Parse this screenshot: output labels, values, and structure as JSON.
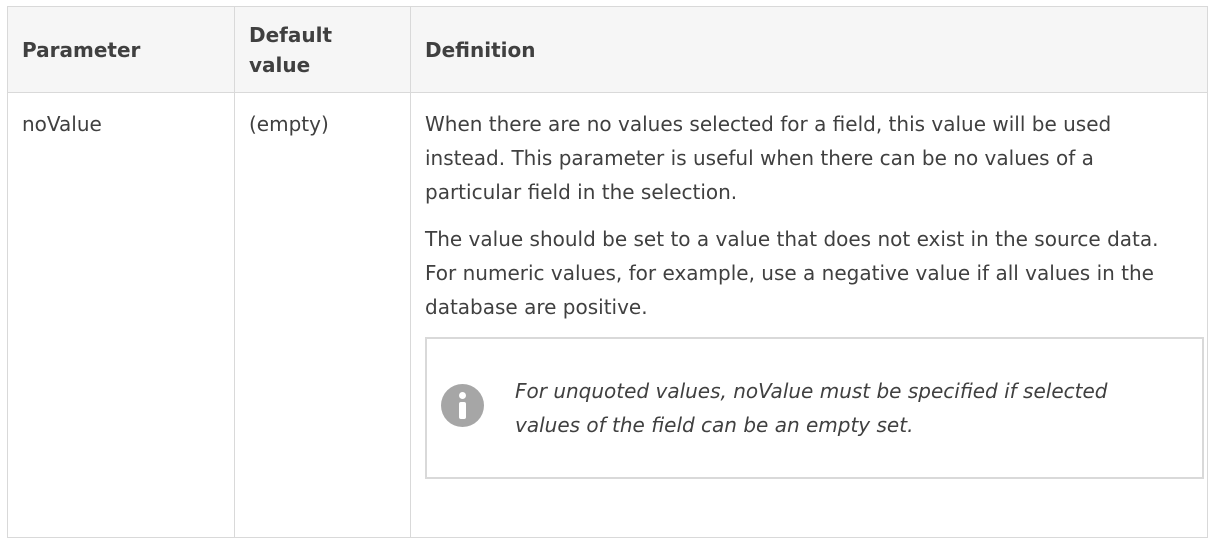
{
  "table": {
    "headers": {
      "parameter": "Parameter",
      "default_value_line1": "Default",
      "default_value_line2": "value",
      "definition": "Definition"
    },
    "rows": [
      {
        "parameter": "noValue",
        "default_value": "(empty)",
        "definition_paragraphs": [
          "When there are no values selected for a field, this value will be used instead. This parameter is useful when there can be no values of a particular field in the selection.",
          "The value should be set to a value that does not exist in the source data. For numeric values, for example, use a negative value if all values in the database are positive."
        ],
        "note": {
          "icon": "info-icon",
          "text": "For unquoted values, noValue must be specified if selected values of the field can be an empty set."
        }
      }
    ]
  }
}
